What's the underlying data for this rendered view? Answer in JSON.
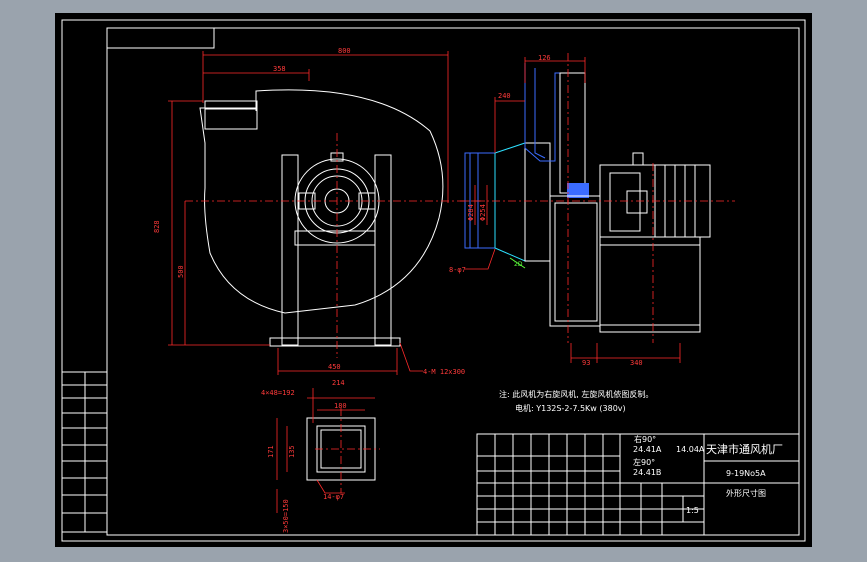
{
  "colors": {
    "background": "#9aa3ad",
    "viewport": "#000000",
    "outline": "#ffffff",
    "dimension": "#ff2a2a",
    "part_blue": "#3b6cff",
    "part_cyan": "#2de0ff",
    "note": "#ffffff"
  },
  "front_view": {
    "dim_top_width": "800",
    "dim_inlet_width": "358",
    "dim_total_height": "828",
    "dim_shaft_height": "500",
    "dim_base_width": "450",
    "dim_bolt_holes": "4-M 12x300"
  },
  "side_view": {
    "dim_outlet_width": "126",
    "dim_inlet_depth": "240",
    "dim_flange_outer": "Φ284",
    "dim_flange_inner": "Φ254",
    "dim_flange_bolts": "8-φ7",
    "dim_motor_offset": "93",
    "dim_motor_length": "340",
    "small_tag": "2D"
  },
  "outlet_view": {
    "dim_flange_pitch": "4×48=192",
    "dim_flange_outer": "214",
    "dim_inner": "180",
    "dim_height_outer": "171",
    "dim_height_inner": "135",
    "dim_bolts": "14-φ7",
    "dim_bottom_pitch": "3×50=150"
  },
  "notes": {
    "line1": "注: 此风机为右旋风机, 左旋风机依图反制。",
    "line2": "电机: Y132S-2-7.5Kw     (380v)"
  },
  "title_block": {
    "company": "天津市通风机厂",
    "model": "9-19No5A",
    "drawing_name": "外形尺寸图",
    "scale": "1:5",
    "right_angle": "右90°",
    "right_code": "24.41A",
    "weight": "14.04A",
    "left_angle": "左90°",
    "left_code": "24.41B"
  }
}
